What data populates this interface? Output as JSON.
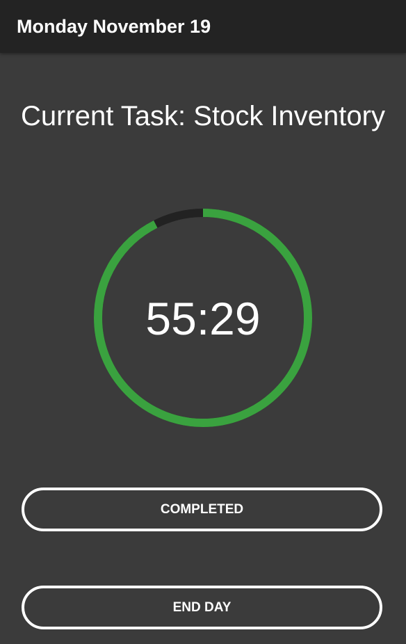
{
  "app_bar": {
    "title": "Monday November 19"
  },
  "task": {
    "title": "Current Task: Stock Inventory"
  },
  "timer": {
    "display": "55:29",
    "progress_fraction": 0.925,
    "colors": {
      "progress": "#3aa23f",
      "track": "#222222"
    }
  },
  "actions": {
    "completed_label": "COMPLETED",
    "end_day_label": "END DAY"
  }
}
